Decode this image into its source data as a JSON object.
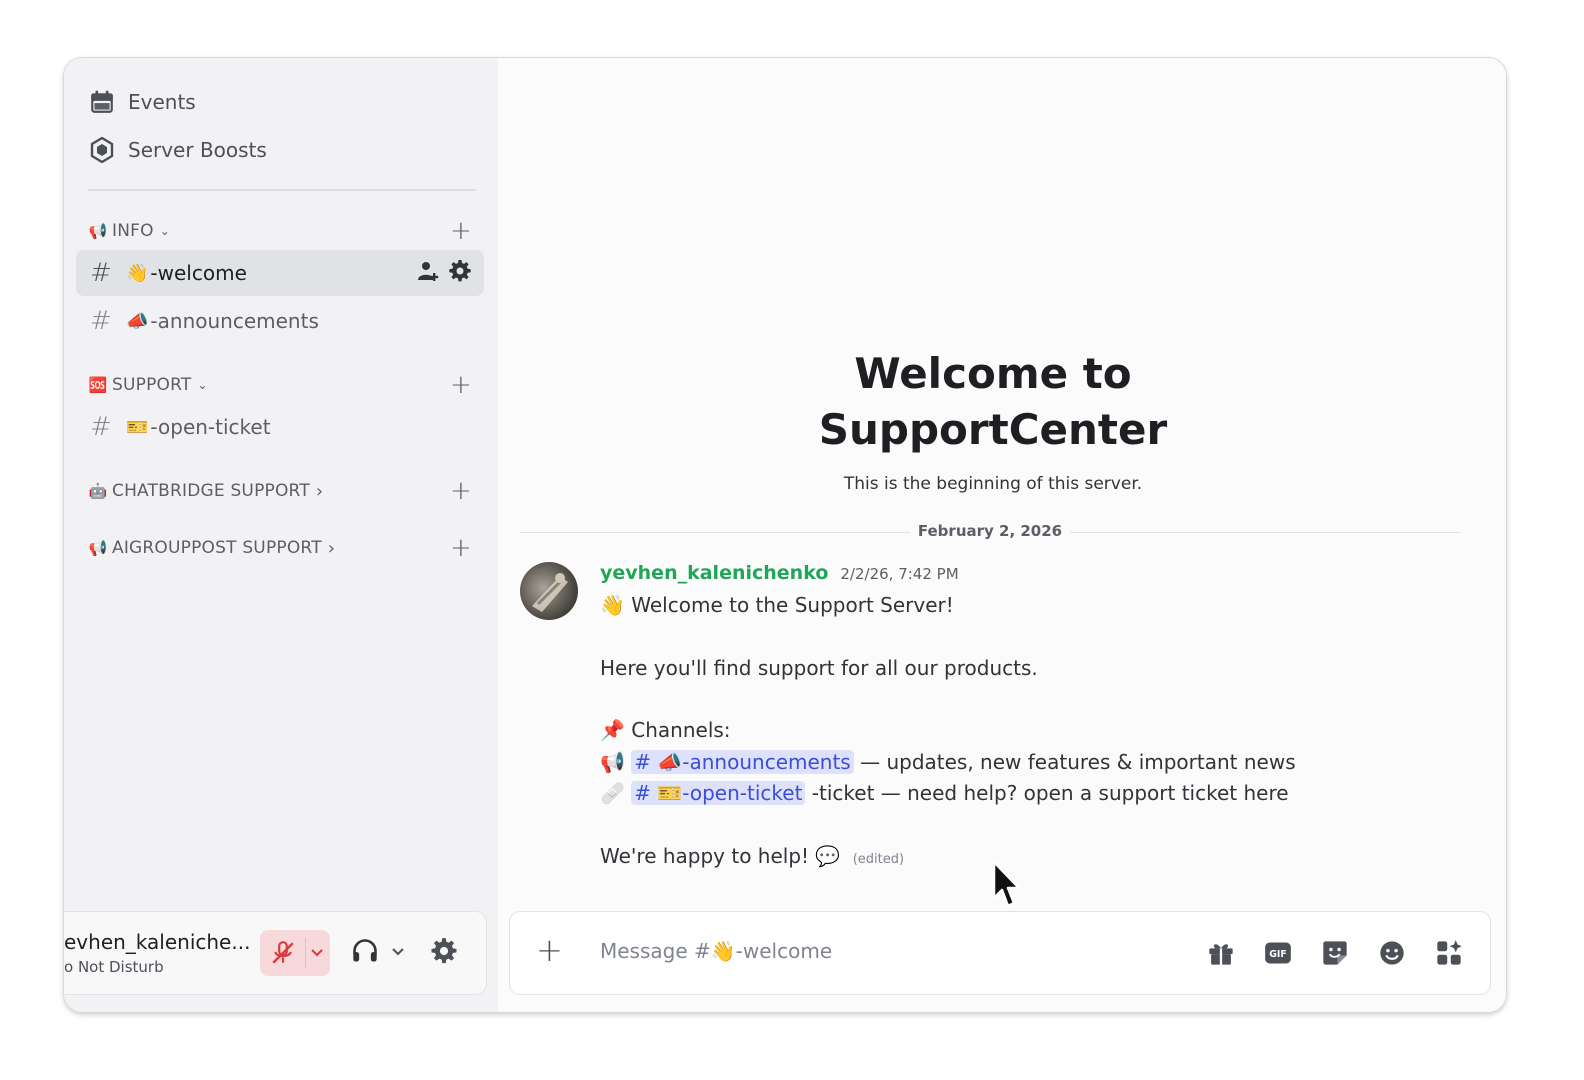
{
  "sidebar": {
    "nav": [
      {
        "label": "Events",
        "icon": "calendar-icon"
      },
      {
        "label": "Server Boosts",
        "icon": "boost-icon"
      }
    ],
    "categories": [
      {
        "emoji": "📢",
        "label": "INFO",
        "chevron": "⌄"
      },
      {
        "emoji": "🆘",
        "label": "SUPPORT",
        "chevron": "⌄"
      },
      {
        "emoji": "🤖",
        "label": "CHATBRIDGE SUPPORT",
        "chevron": "›"
      },
      {
        "emoji": "📢",
        "label": "AIGROUPPOST SUPPORT",
        "chevron": "›"
      }
    ],
    "channels": [
      {
        "hash": "#",
        "emoji": "👋",
        "label": "-welcome"
      },
      {
        "hash": "#",
        "emoji": "📣",
        "label": "-announcements"
      },
      {
        "hash": "#",
        "emoji": "🎫",
        "label": "-open-ticket"
      }
    ],
    "user": {
      "name": "evhen_kaleniche...",
      "status": "o Not Disturb"
    }
  },
  "main": {
    "welcome_title_1": "Welcome to",
    "welcome_title_2": "SupportCenter",
    "welcome_sub": "This is the beginning of this server.",
    "date": "February 2, 2026",
    "message": {
      "author": "yevhen_kalenichenko",
      "timestamp": "2/2/26, 7:42 PM",
      "line1_emoji": "👋",
      "line1": "Welcome to the Support Server!",
      "line2": "Here you'll find support for all our products.",
      "line3_emoji": "📌",
      "line3": "Channels:",
      "line4_emoji": "📢",
      "line4_mention": "# 📣-announcements",
      "line4_text": " — updates, new features & important news",
      "line5_emoji": "🩹",
      "line5_mention": "# 🎫-open-ticket",
      "line5_text": " -ticket  — need help? open a support ticket here",
      "line6": "We're happy to help!",
      "line6_emoji": "💬",
      "edited": "(edited)"
    },
    "composer": {
      "placeholder": "Message #👋-welcome",
      "gif_label": "GIF"
    }
  },
  "colors": {
    "author": "#23a559",
    "mention_bg": "#dde1fb",
    "mention_fg": "#3b4fd6",
    "mute_bg": "#f7d9dc",
    "mute_icon": "#d83c3e"
  }
}
